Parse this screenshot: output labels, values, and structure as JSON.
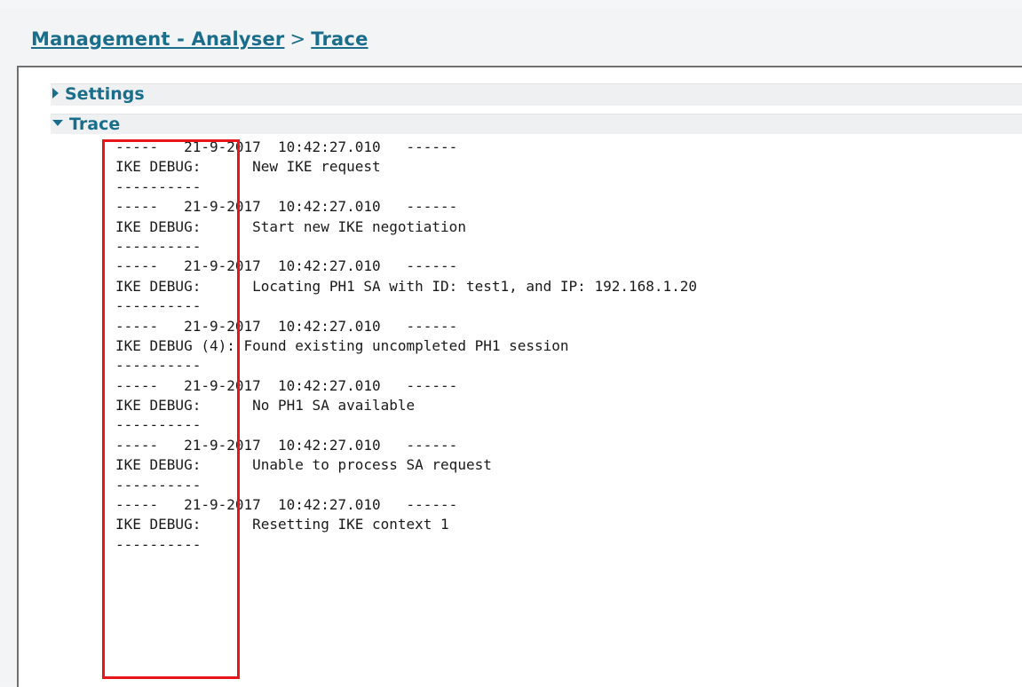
{
  "breadcrumb": {
    "parent": "Management - Analyser",
    "separator": ">",
    "current": "Trace"
  },
  "sections": {
    "settings": {
      "label": "Settings",
      "icon": "triangle-right-icon",
      "expanded": false
    },
    "trace": {
      "label": "Trace",
      "icon": "triangle-down-icon",
      "expanded": true
    }
  },
  "trace_lines": [
    "-----   21-9-2017  10:42:27.010   ------",
    "IKE DEBUG:      New IKE request",
    "----------",
    "-----   21-9-2017  10:42:27.010   ------",
    "IKE DEBUG:      Start new IKE negotiation",
    "----------",
    "-----   21-9-2017  10:42:27.010   ------",
    "IKE DEBUG:      Locating PH1 SA with ID: test1, and IP: 192.168.1.20",
    "----------",
    "-----   21-9-2017  10:42:27.010   ------",
    "IKE DEBUG (4): Found existing uncompleted PH1 session",
    "----------",
    "-----   21-9-2017  10:42:27.010   ------",
    "IKE DEBUG:      No PH1 SA available",
    "----------",
    "-----   21-9-2017  10:42:27.010   ------",
    "IKE DEBUG:      Unable to process SA request",
    "----------",
    "-----   21-9-2017  10:42:27.010   ------",
    "IKE DEBUG:      Resetting IKE context 1",
    "----------"
  ],
  "colors": {
    "link": "#1a6e8c",
    "highlight": "#e8151b",
    "panel_border": "#707070"
  }
}
